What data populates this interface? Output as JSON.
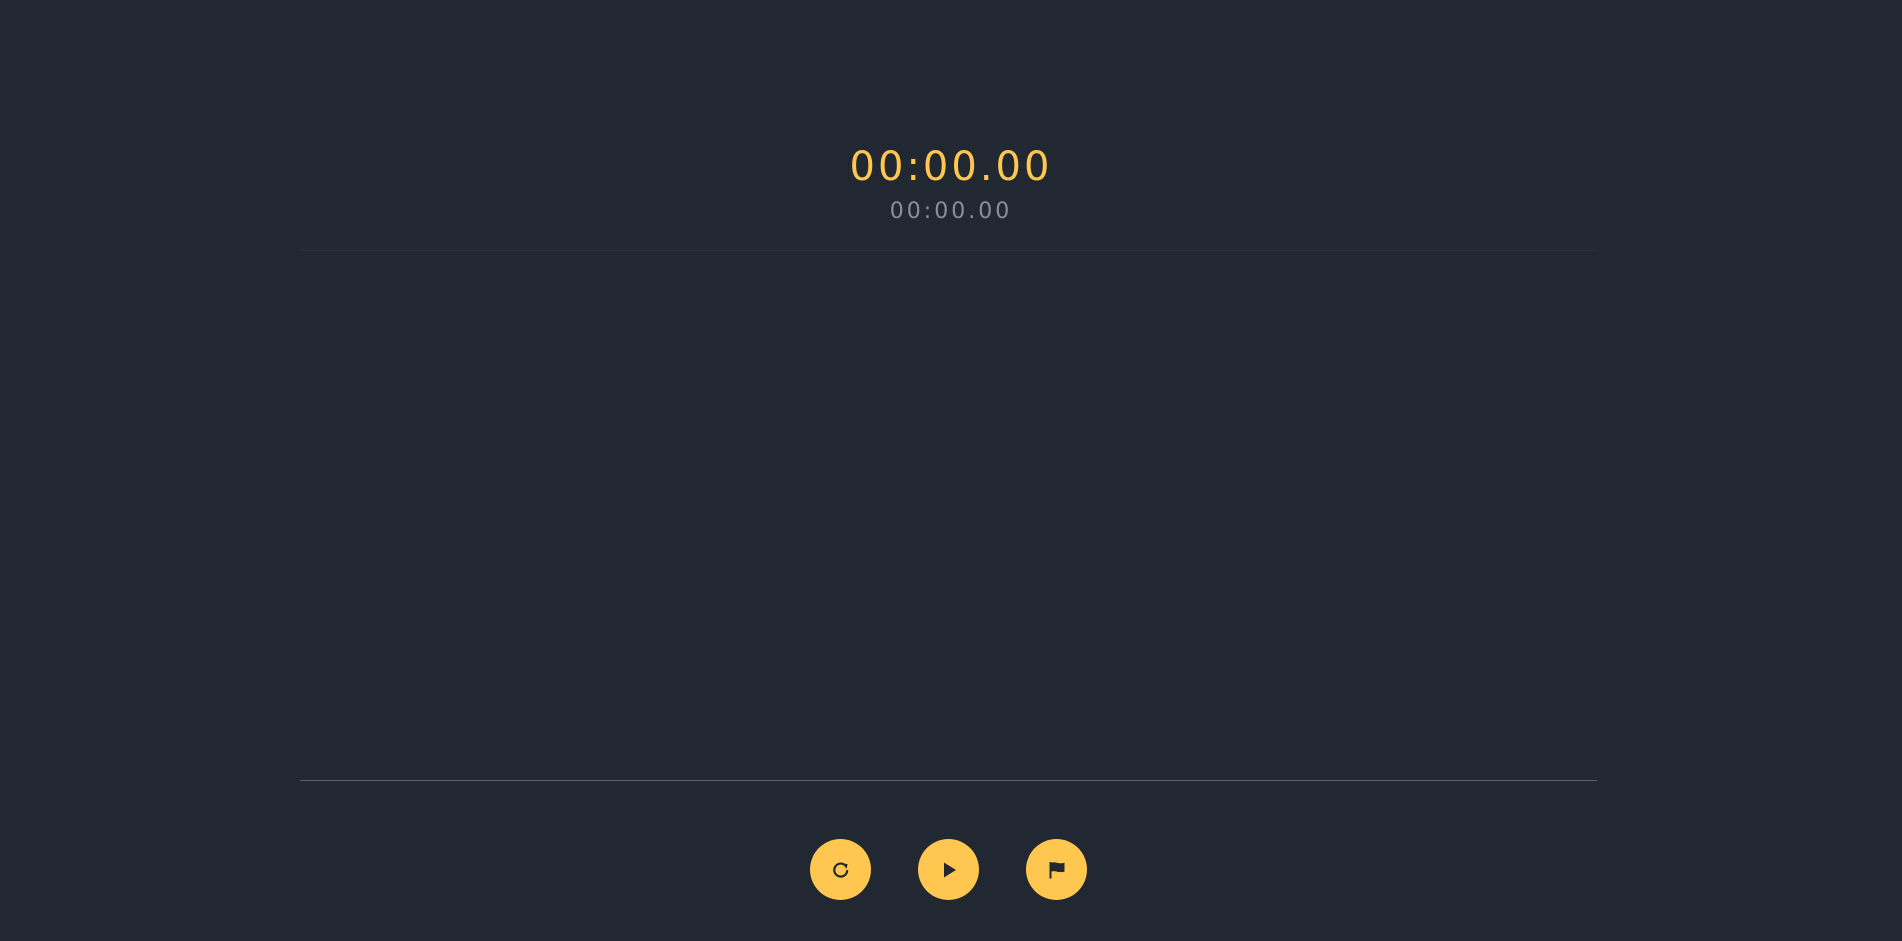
{
  "stopwatch": {
    "main_time": "00:00.00",
    "lap_time": "00:00.00"
  },
  "laps": [],
  "controls": {
    "reset_icon": "reset-icon",
    "play_icon": "play-icon",
    "lap_icon": "flag-icon"
  },
  "colors": {
    "background": "#222831",
    "accent": "#ffc74f",
    "secondary_text": "#8a8f98",
    "icon": "#222831"
  }
}
